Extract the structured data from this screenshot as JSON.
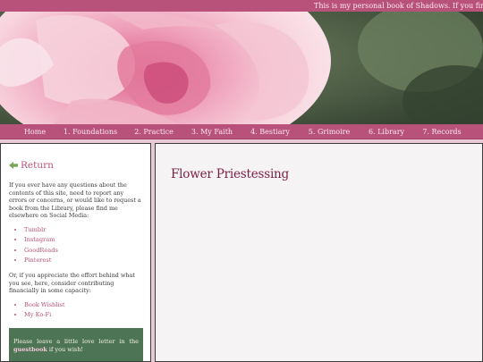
{
  "marquee": {
    "text": "This is my personal book of Shadows. If you find it u"
  },
  "nav": {
    "items": [
      {
        "label": "Home"
      },
      {
        "label": "1. Foundations"
      },
      {
        "label": "2. Practice"
      },
      {
        "label": "3. My Faith"
      },
      {
        "label": "4. Bestiary"
      },
      {
        "label": "5. Grimoire"
      },
      {
        "label": "6. Library"
      },
      {
        "label": "7. Records"
      }
    ]
  },
  "sidebar": {
    "return_label": "Return",
    "intro": "If you ever have any questions about the contents of this site, need to report any errors or concerns, or would like to request a book from the Library, please find me elsewhere on Social Media:",
    "social_links": [
      {
        "label": "Tumblr"
      },
      {
        "label": "Instagram"
      },
      {
        "label": "GoodReads"
      },
      {
        "label": "Pinterest"
      }
    ],
    "support_text": "Or, if you appreciate the effort behind what you see, here, consider contributing financially in some capacity:",
    "support_links": [
      {
        "label": "Book Wishlist"
      },
      {
        "label": "My Ko-Fi"
      }
    ],
    "guestbook": {
      "before": "Please leave a little love letter in the ",
      "link": "guestbook",
      "after": " if you wish!"
    }
  },
  "main": {
    "title": "Flower Priestessing"
  },
  "colors": {
    "accent": "#b8527a",
    "title": "#7b1c44",
    "guestbook_bg": "#4e7456"
  },
  "icons": {
    "return": "arrow-left-icon"
  }
}
